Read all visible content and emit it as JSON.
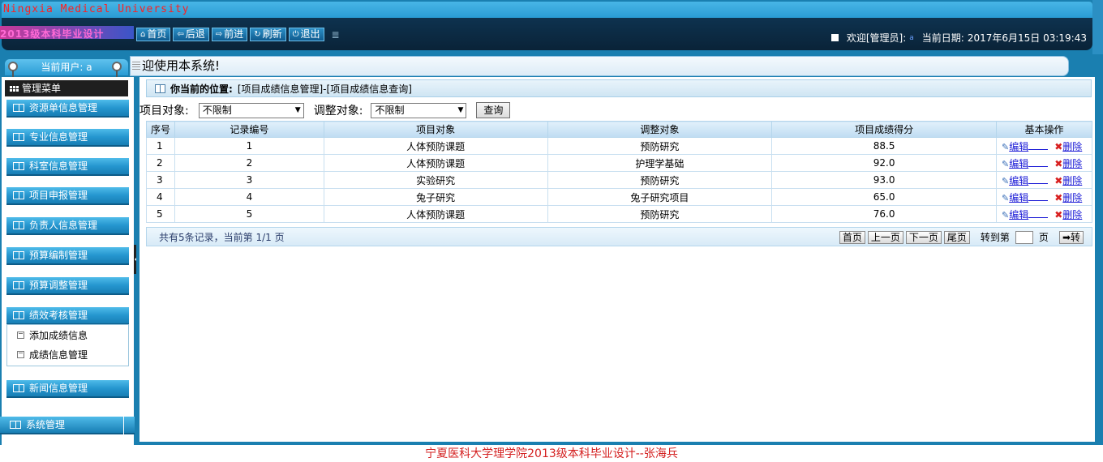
{
  "header": {
    "site_title": "Ningxia Medical University",
    "logo_text": "2013级本科毕业设计",
    "toolbar": [
      {
        "icon": "home-icon",
        "glyph": "⌂",
        "label": "首页"
      },
      {
        "icon": "back-icon",
        "glyph": "⇦",
        "label": "后退"
      },
      {
        "icon": "forward-icon",
        "glyph": "⇨",
        "label": "前进"
      },
      {
        "icon": "refresh-icon",
        "glyph": "↻",
        "label": "刷新"
      },
      {
        "icon": "power-icon",
        "glyph": "⏻",
        "label": "退出"
      }
    ],
    "toolbar_sep": "≣",
    "welcome": "欢迎[管理员]:",
    "user": "a",
    "date_label": "当前日期:",
    "date_value": "2017年6月15日 03:19:43"
  },
  "sidebar": {
    "current_user": "当前用户: a",
    "menu_head": "管理菜单",
    "items": [
      {
        "label": "资源单信息管理"
      },
      {
        "label": "专业信息管理"
      },
      {
        "label": "科室信息管理"
      },
      {
        "label": "项目申报管理"
      },
      {
        "label": "负责人信息管理"
      },
      {
        "label": "预算编制管理"
      },
      {
        "label": "预算调整管理"
      },
      {
        "label": "绩效考核管理"
      }
    ],
    "subitems": [
      {
        "label": "添加成绩信息"
      },
      {
        "label": "成绩信息管理"
      }
    ],
    "news": "新闻信息管理",
    "system": "系统管理"
  },
  "marquee": "迎使用本系统!",
  "breadcrumb": {
    "label": "你当前的位置:",
    "path": "[项目成绩信息管理]-[项目成绩信息查询]"
  },
  "filter": {
    "project_label": "项目对象:",
    "project_value": "不限制",
    "adjust_label": "调整对象:",
    "adjust_value": "不限制",
    "query_button": "查询"
  },
  "table": {
    "headers": [
      "序号",
      "记录编号",
      "项目对象",
      "调整对象",
      "项目成绩得分",
      "基本操作"
    ],
    "rows": [
      [
        "1",
        "1",
        "人体预防课题",
        "预防研究",
        "88.5"
      ],
      [
        "2",
        "2",
        "人体预防课题",
        "护理学基础",
        "92.0"
      ],
      [
        "3",
        "3",
        "实验研究",
        "预防研究",
        "93.0"
      ],
      [
        "4",
        "4",
        "兔子研究",
        "兔子研究项目",
        "65.0"
      ],
      [
        "5",
        "5",
        "人体预防课题",
        "预防研究",
        "76.0"
      ]
    ],
    "edit_label": "编辑",
    "delete_label": "删除"
  },
  "pager": {
    "summary": "共有5条记录，当前第 1/1 页",
    "first": "首页",
    "prev": "上一页",
    "next": "下一页",
    "last": "尾页",
    "goto_label": "转到第",
    "page_unit": "页",
    "go_button": "➡转"
  },
  "footer": "宁夏医科大学理学院2013级本科毕业设计--张海兵"
}
